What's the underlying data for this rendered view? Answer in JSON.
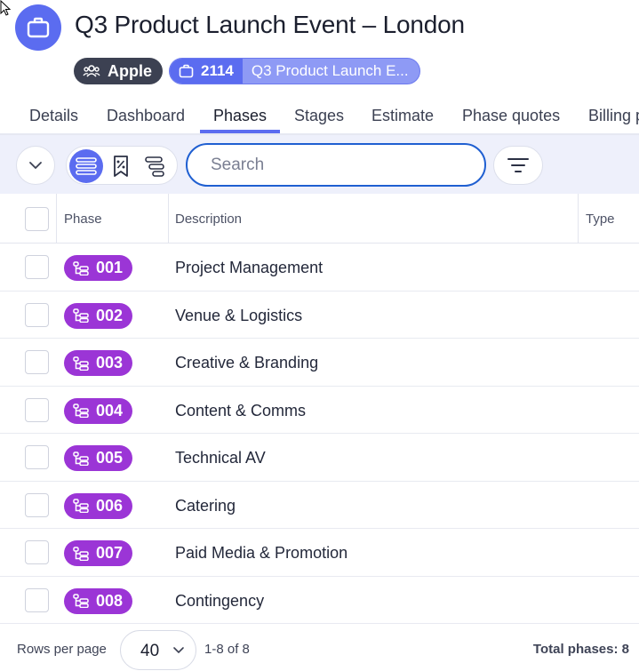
{
  "header": {
    "title": "Q3 Product Launch Event – London",
    "client_chip": "Apple",
    "project_number": "2114",
    "project_name": "Q3 Product Launch E..."
  },
  "tabs": [
    {
      "label": "Details"
    },
    {
      "label": "Dashboard"
    },
    {
      "label": "Phases",
      "active": true
    },
    {
      "label": "Stages"
    },
    {
      "label": "Estimate"
    },
    {
      "label": "Phase quotes"
    },
    {
      "label": "Billing p"
    }
  ],
  "toolbar": {
    "search_placeholder": "Search"
  },
  "table": {
    "columns": [
      "Phase",
      "Description",
      "Type"
    ],
    "rows": [
      {
        "phase": "001",
        "description": "Project Management"
      },
      {
        "phase": "002",
        "description": "Venue & Logistics"
      },
      {
        "phase": "003",
        "description": "Creative & Branding"
      },
      {
        "phase": "004",
        "description": "Content & Comms"
      },
      {
        "phase": "005",
        "description": "Technical AV"
      },
      {
        "phase": "006",
        "description": "Catering"
      },
      {
        "phase": "007",
        "description": "Paid Media & Promotion"
      },
      {
        "phase": "008",
        "description": "Contingency"
      }
    ]
  },
  "footer": {
    "rows_per_page_label": "Rows per page",
    "rows_per_page_value": "40",
    "range_text": "1-8 of 8",
    "total_text": "Total phases: 8"
  },
  "colors": {
    "accent": "#5b6cf0",
    "phase_badge": "#9b35d6",
    "search_border": "#1f5fd1",
    "client_chip": "#3c4152"
  }
}
